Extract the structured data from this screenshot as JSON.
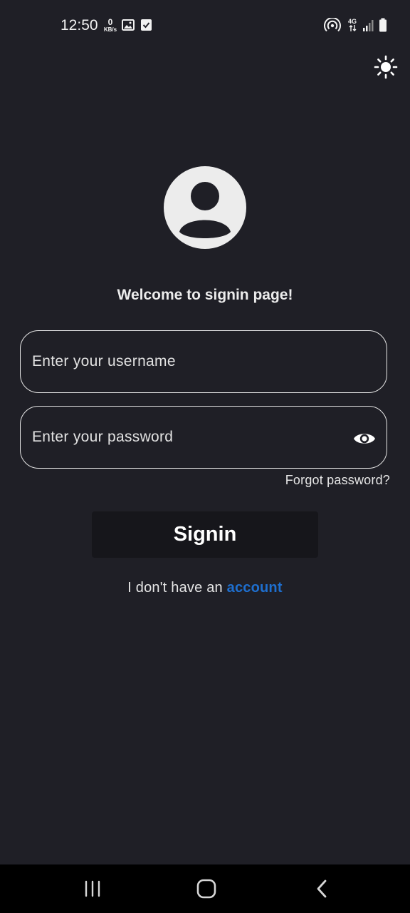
{
  "status_bar": {
    "time": "12:50",
    "net_speed_value": "0",
    "net_speed_unit": "KB/s",
    "icons": [
      "image-icon",
      "checkbox-icon",
      "hotspot-icon",
      "4g-signal-icon",
      "battery-icon"
    ]
  },
  "header": {
    "theme_toggle_icon": "sun-icon"
  },
  "signin": {
    "avatar_icon": "account-circle-icon",
    "welcome": "Welcome to signin page!",
    "username_placeholder": "Enter your username",
    "username_value": "",
    "password_placeholder": "Enter your password",
    "password_value": "",
    "password_visibility_icon": "eye-icon",
    "forgot_password": "Forgot password?",
    "signin_button": "Signin",
    "no_account_text": "I don't have an",
    "account_link": "account"
  },
  "colors": {
    "background": "#1f1f26",
    "button_bg": "#16161b",
    "link": "#1e6fcf",
    "text": "#ececec"
  },
  "nav_bar": {
    "buttons": [
      "recent-apps-icon",
      "home-icon",
      "back-icon"
    ]
  }
}
